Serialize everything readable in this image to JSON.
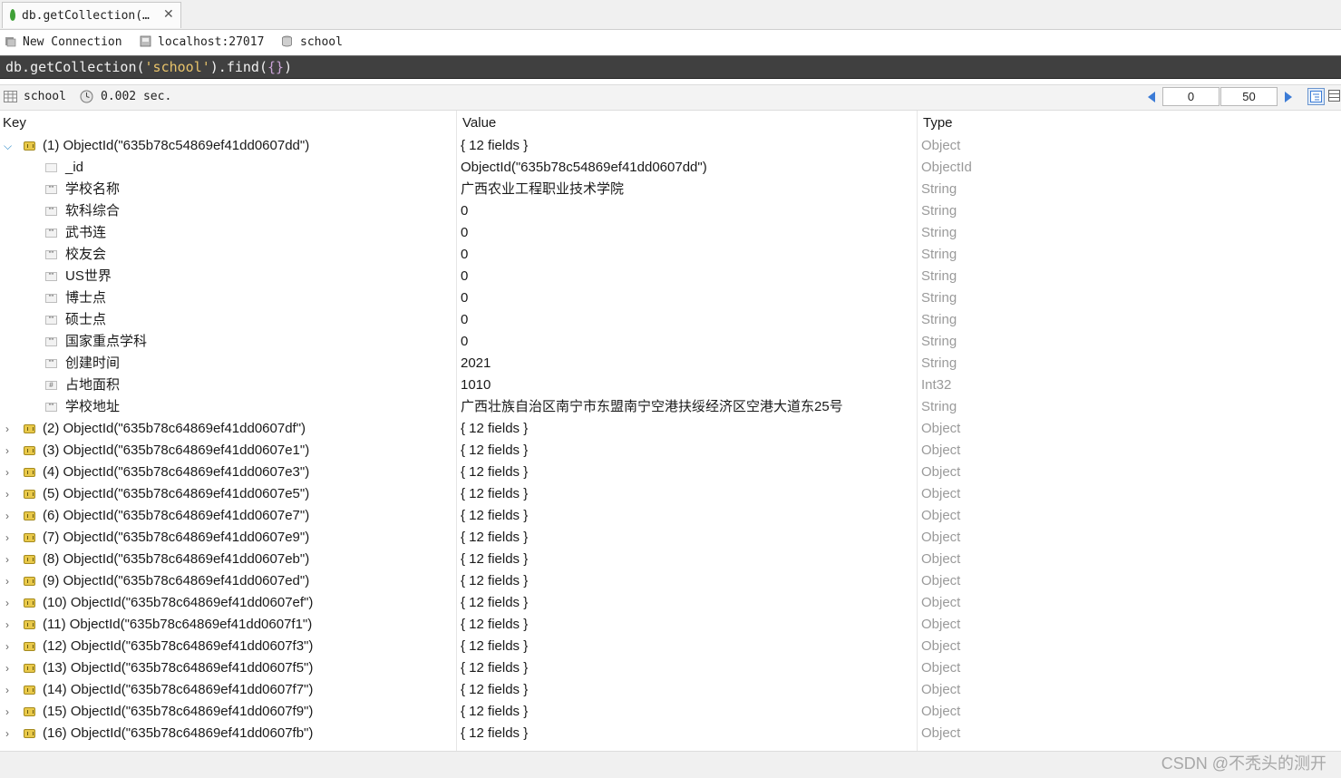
{
  "tab": {
    "title": "db.getCollection(…",
    "close": "✕"
  },
  "connection": {
    "new_connection": "New Connection",
    "host": "localhost:27017",
    "database": "school"
  },
  "query": {
    "prefix": "db.getCollection(",
    "arg": "'school'",
    "middle": ").find(",
    "inner": "{}",
    "suffix": ")"
  },
  "result": {
    "collection": "school",
    "time": "0.002 sec.",
    "skip": "0",
    "limit": "50"
  },
  "columns": {
    "key": "Key",
    "value": "Value",
    "type": "Type"
  },
  "expanded": {
    "key": "(1) ObjectId(\"635b78c54869ef41dd0607dd\")",
    "value": "{ 12 fields }",
    "type": "Object",
    "fields": [
      {
        "key": "_id",
        "value": "ObjectId(\"635b78c54869ef41dd0607dd\")",
        "type": "ObjectId",
        "icon": "objectid-icon"
      },
      {
        "key": "学校名称",
        "value": "广西农业工程职业技术学院",
        "type": "String",
        "icon": "string-icon"
      },
      {
        "key": "软科综合",
        "value": "0",
        "type": "String",
        "icon": "string-icon"
      },
      {
        "key": "武书连",
        "value": "0",
        "type": "String",
        "icon": "string-icon"
      },
      {
        "key": "校友会",
        "value": "0",
        "type": "String",
        "icon": "string-icon"
      },
      {
        "key": "US世界",
        "value": "0",
        "type": "String",
        "icon": "string-icon"
      },
      {
        "key": "博士点",
        "value": "0",
        "type": "String",
        "icon": "string-icon"
      },
      {
        "key": "硕士点",
        "value": "0",
        "type": "String",
        "icon": "string-icon"
      },
      {
        "key": "国家重点学科",
        "value": "0",
        "type": "String",
        "icon": "string-icon"
      },
      {
        "key": "创建时间",
        "value": "2021",
        "type": "String",
        "icon": "string-icon"
      },
      {
        "key": "占地面积",
        "value": "1010",
        "type": "Int32",
        "icon": "int32-icon"
      },
      {
        "key": "学校地址",
        "value": "广西壮族自治区南宁市东盟南宁空港扶绥经济区空港大道东25号",
        "type": "String",
        "icon": "string-icon"
      }
    ]
  },
  "documents": [
    {
      "key": "(2) ObjectId(\"635b78c64869ef41dd0607df\")",
      "value": "{ 12 fields }",
      "type": "Object"
    },
    {
      "key": "(3) ObjectId(\"635b78c64869ef41dd0607e1\")",
      "value": "{ 12 fields }",
      "type": "Object"
    },
    {
      "key": "(4) ObjectId(\"635b78c64869ef41dd0607e3\")",
      "value": "{ 12 fields }",
      "type": "Object"
    },
    {
      "key": "(5) ObjectId(\"635b78c64869ef41dd0607e5\")",
      "value": "{ 12 fields }",
      "type": "Object"
    },
    {
      "key": "(6) ObjectId(\"635b78c64869ef41dd0607e7\")",
      "value": "{ 12 fields }",
      "type": "Object"
    },
    {
      "key": "(7) ObjectId(\"635b78c64869ef41dd0607e9\")",
      "value": "{ 12 fields }",
      "type": "Object"
    },
    {
      "key": "(8) ObjectId(\"635b78c64869ef41dd0607eb\")",
      "value": "{ 12 fields }",
      "type": "Object"
    },
    {
      "key": "(9) ObjectId(\"635b78c64869ef41dd0607ed\")",
      "value": "{ 12 fields }",
      "type": "Object"
    },
    {
      "key": "(10) ObjectId(\"635b78c64869ef41dd0607ef\")",
      "value": "{ 12 fields }",
      "type": "Object"
    },
    {
      "key": "(11) ObjectId(\"635b78c64869ef41dd0607f1\")",
      "value": "{ 12 fields }",
      "type": "Object"
    },
    {
      "key": "(12) ObjectId(\"635b78c64869ef41dd0607f3\")",
      "value": "{ 12 fields }",
      "type": "Object"
    },
    {
      "key": "(13) ObjectId(\"635b78c64869ef41dd0607f5\")",
      "value": "{ 12 fields }",
      "type": "Object"
    },
    {
      "key": "(14) ObjectId(\"635b78c64869ef41dd0607f7\")",
      "value": "{ 12 fields }",
      "type": "Object"
    },
    {
      "key": "(15) ObjectId(\"635b78c64869ef41dd0607f9\")",
      "value": "{ 12 fields }",
      "type": "Object"
    },
    {
      "key": "(16) ObjectId(\"635b78c64869ef41dd0607fb\")",
      "value": "{ 12 fields }",
      "type": "Object"
    }
  ],
  "watermark": "CSDN @不秃头的测开",
  "colors": {
    "query_bg": "#404040",
    "query_string": "#e8c36a",
    "query_paren": "#c9a2d6",
    "type_text": "#9a9a9a",
    "accent": "#3b7bd6"
  }
}
